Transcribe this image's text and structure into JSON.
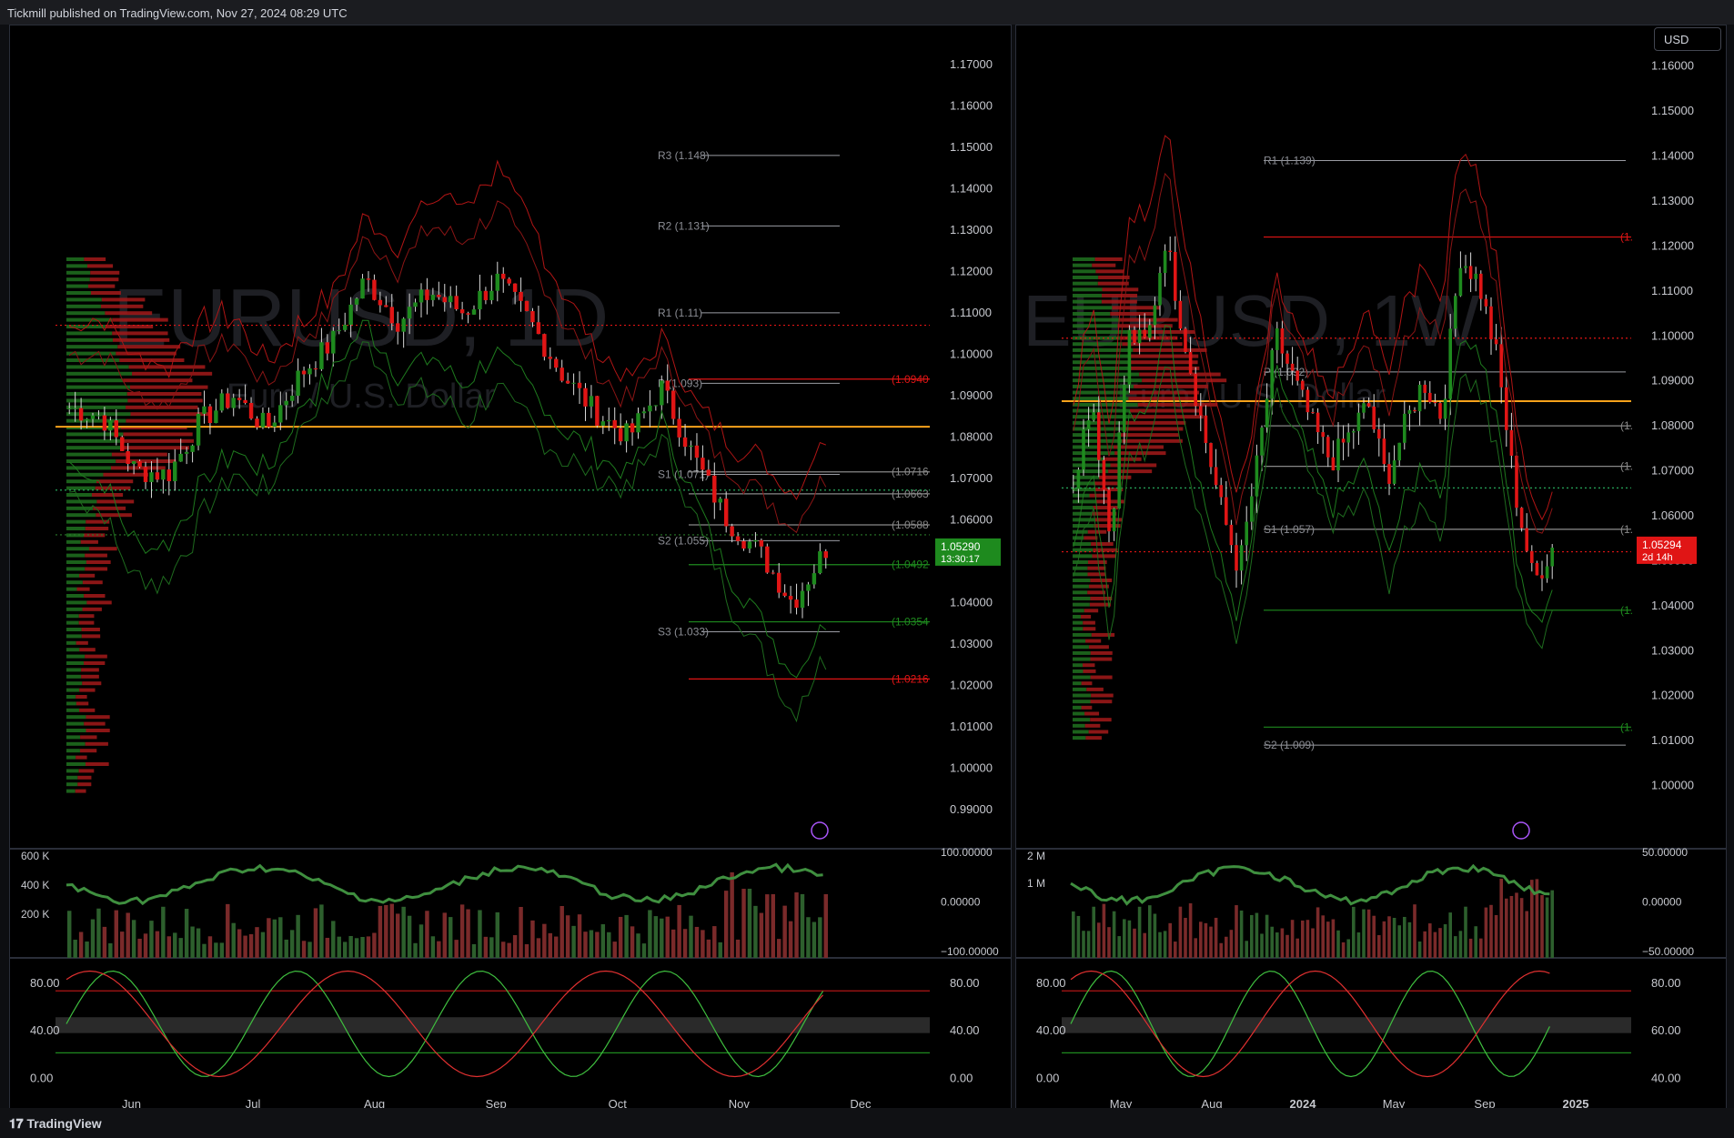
{
  "header": {
    "published": "Tickmill published on TradingView.com, Nov 27, 2024 08:29 UTC"
  },
  "footer": {
    "brand": "TradingView",
    "icon": "tradingview-logo-icon"
  },
  "currency_button": "USD",
  "colors": {
    "up": "#1e8a1e",
    "down": "#e01515",
    "orange": "#f7a21b",
    "green_dot": "#26a65b"
  },
  "chart_data": [
    {
      "type": "line",
      "watermark": "EURUSD, 1D",
      "watermark_sub": "Euro / U.S. Dollar",
      "price_ticks": [
        "1.17000",
        "1.16000",
        "1.15000",
        "1.14000",
        "1.13000",
        "1.12000",
        "1.11000",
        "1.10000",
        "1.09000",
        "1.08000",
        "1.07000",
        "1.06000",
        "1.05000",
        "1.04000",
        "1.03000",
        "1.02000",
        "1.01000",
        "1.00000",
        "0.99000"
      ],
      "price_ticks_values": [
        1.17,
        1.16,
        1.15,
        1.14,
        1.13,
        1.12,
        1.11,
        1.1,
        1.09,
        1.08,
        1.07,
        1.06,
        1.05,
        1.04,
        1.03,
        1.02,
        1.01,
        1.0,
        0.99
      ],
      "x_ticks": [
        "Jun",
        "Jul",
        "Aug",
        "Sep",
        "Oct",
        "Nov",
        "Dec"
      ],
      "ylim": [
        0.985,
        1.175
      ],
      "pivots": [
        {
          "label": "R3 (1.148)",
          "value": 1.148
        },
        {
          "label": "R2 (1.131)",
          "value": 1.131
        },
        {
          "label": "R1 (1.11)",
          "value": 1.11
        },
        {
          "label": "P (1.093)",
          "value": 1.093
        },
        {
          "label": "S1 (1.071)",
          "value": 1.071
        },
        {
          "label": "S2 (1.055)",
          "value": 1.055
        },
        {
          "label": "S3 (1.033)",
          "value": 1.033
        }
      ],
      "levels": [
        {
          "label": "(1.0940",
          "value": 1.094,
          "color": "#e01515"
        },
        {
          "label": "(1.0716",
          "value": 1.0716,
          "color": "#888888"
        },
        {
          "label": "(1.0663",
          "value": 1.0663,
          "color": "#888888"
        },
        {
          "label": "(1.0588",
          "value": 1.0588,
          "color": "#888888"
        },
        {
          "label": "(1.0492",
          "value": 1.0492,
          "color": "#1e8a1e"
        },
        {
          "label": "(1.0354",
          "value": 1.0354,
          "color": "#1e8a1e"
        },
        {
          "label": "(1.0216",
          "value": 1.0216,
          "color": "#e01515"
        }
      ],
      "last_price": {
        "value": "1.05290",
        "countdown": "13:30:17",
        "y": 1.0529
      },
      "volume_ticks": [
        "600 K",
        "400 K",
        "200 K"
      ],
      "osc_ticks": [
        "100.00000",
        "0.00000",
        "−100.00000"
      ],
      "stoch_ticks_left": [
        "80.00",
        "40.00",
        "0.00"
      ],
      "stoch_ticks_right": [
        "80.00",
        "40.00",
        "0.00"
      ]
    },
    {
      "type": "line",
      "watermark": "EURUSD, 1W",
      "watermark_sub": "Euro / U.S. Dollar",
      "price_ticks": [
        "1.16000",
        "1.15000",
        "1.14000",
        "1.13000",
        "1.12000",
        "1.11000",
        "1.10000",
        "1.09000",
        "1.08000",
        "1.07000",
        "1.06000",
        "1.05000",
        "1.04000",
        "1.03000",
        "1.02000",
        "1.01000",
        "1.00000"
      ],
      "price_ticks_values": [
        1.16,
        1.15,
        1.14,
        1.13,
        1.12,
        1.11,
        1.1,
        1.09,
        1.08,
        1.07,
        1.06,
        1.05,
        1.04,
        1.03,
        1.02,
        1.01,
        1.0
      ],
      "x_ticks": [
        "May",
        "Aug",
        "2024",
        "May",
        "Sep",
        "2025"
      ],
      "ylim": [
        0.99,
        1.165
      ],
      "pivots": [
        {
          "label": "R1 (1.139)",
          "value": 1.139
        },
        {
          "label": "P (1.092)",
          "value": 1.092
        },
        {
          "label": "S1 (1.057)",
          "value": 1.057
        },
        {
          "label": "S2 (1.009)",
          "value": 1.009
        }
      ],
      "levels": [
        {
          "label": "(1.",
          "value": 1.122,
          "color": "#e01515"
        },
        {
          "label": "(1.",
          "value": 1.08,
          "color": "#888888"
        },
        {
          "label": "(1.",
          "value": 1.071,
          "color": "#888888"
        },
        {
          "label": "(1.",
          "value": 1.057,
          "color": "#888888"
        },
        {
          "label": "(1.",
          "value": 1.039,
          "color": "#1e8a1e"
        },
        {
          "label": "(1.",
          "value": 1.013,
          "color": "#1e8a1e"
        }
      ],
      "last_price": {
        "value": "1.05294",
        "countdown": "2d 14h",
        "y": 1.05294
      },
      "volume_ticks": [
        "2 M",
        "1 M"
      ],
      "osc_ticks": [
        "50.00000",
        "0.00000",
        "−50.00000"
      ],
      "stoch_ticks_left": [
        "80.00",
        "40.00",
        "0.00"
      ],
      "stoch_ticks_right": [
        "80.00",
        "60.00",
        "40.00"
      ]
    }
  ]
}
